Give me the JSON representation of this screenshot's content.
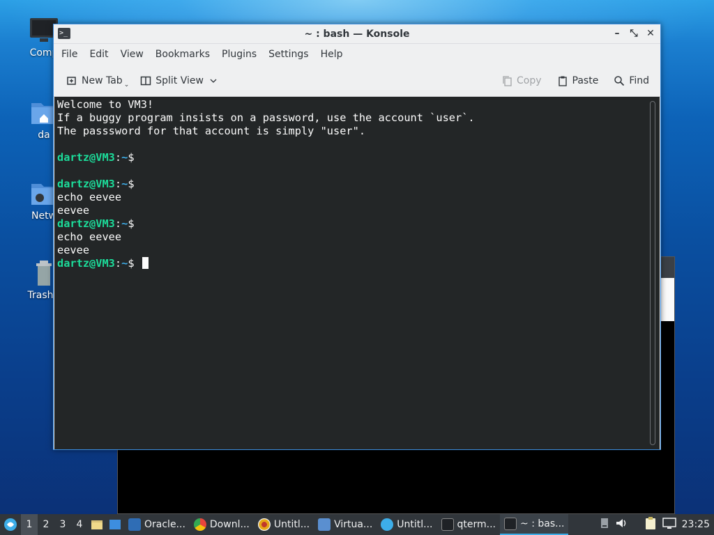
{
  "desktop": {
    "icons": [
      {
        "label": "Comp",
        "icon": "computer-icon"
      },
      {
        "label": "da",
        "icon": "home-folder-icon"
      },
      {
        "label": "Netw",
        "icon": "network-folder-icon"
      },
      {
        "label": "Trash (",
        "icon": "trash-icon"
      }
    ]
  },
  "window": {
    "title": "~ : bash — Konsole",
    "title_icon": ">_",
    "minimize": "–",
    "maximize": "⤡",
    "close": "✕"
  },
  "menubar": [
    "File",
    "Edit",
    "View",
    "Bookmarks",
    "Plugins",
    "Settings",
    "Help"
  ],
  "toolbar": {
    "new_tab": "New Tab",
    "split_view": "Split View",
    "copy": "Copy",
    "paste": "Paste",
    "find": "Find"
  },
  "terminal": {
    "motd": [
      "Welcome to VM3!",
      "If a buggy program insists on a password, use the account `user`.",
      "The passsword for that account is simply \"user\"."
    ],
    "prompt_user": "dartz@VM3",
    "prompt_sep": ":",
    "prompt_path": "~",
    "prompt_end": "$",
    "command": "echo eevee",
    "output": "eevee",
    "colors": {
      "background": "#232627",
      "user": "#1cdc9a",
      "path": "#3daee9",
      "text": "#fcfcfc"
    }
  },
  "taskbar": {
    "desktops": [
      "1",
      "2",
      "3",
      "4"
    ],
    "active_desktop": "1",
    "tasks": [
      {
        "label": "Oracle...",
        "icon": "virtualbox-icon",
        "color": "#2f6db5"
      },
      {
        "label": "Downl...",
        "icon": "chrome-icon",
        "color": "#e8453c"
      },
      {
        "label": "Untitl...",
        "icon": "record-icon",
        "color": "#e6a817"
      },
      {
        "label": "Virtua...",
        "icon": "virtualbox-manager-icon",
        "color": "#5a8fd0"
      },
      {
        "label": "Untitl...",
        "icon": "kde-app-icon",
        "color": "#3daee9"
      },
      {
        "label": "qterm...",
        "icon": "terminal-icon",
        "color": "#3b4046"
      },
      {
        "label": "~ : bas...",
        "icon": "konsole-icon",
        "color": "#3b4046"
      }
    ],
    "clock": "23:25"
  }
}
